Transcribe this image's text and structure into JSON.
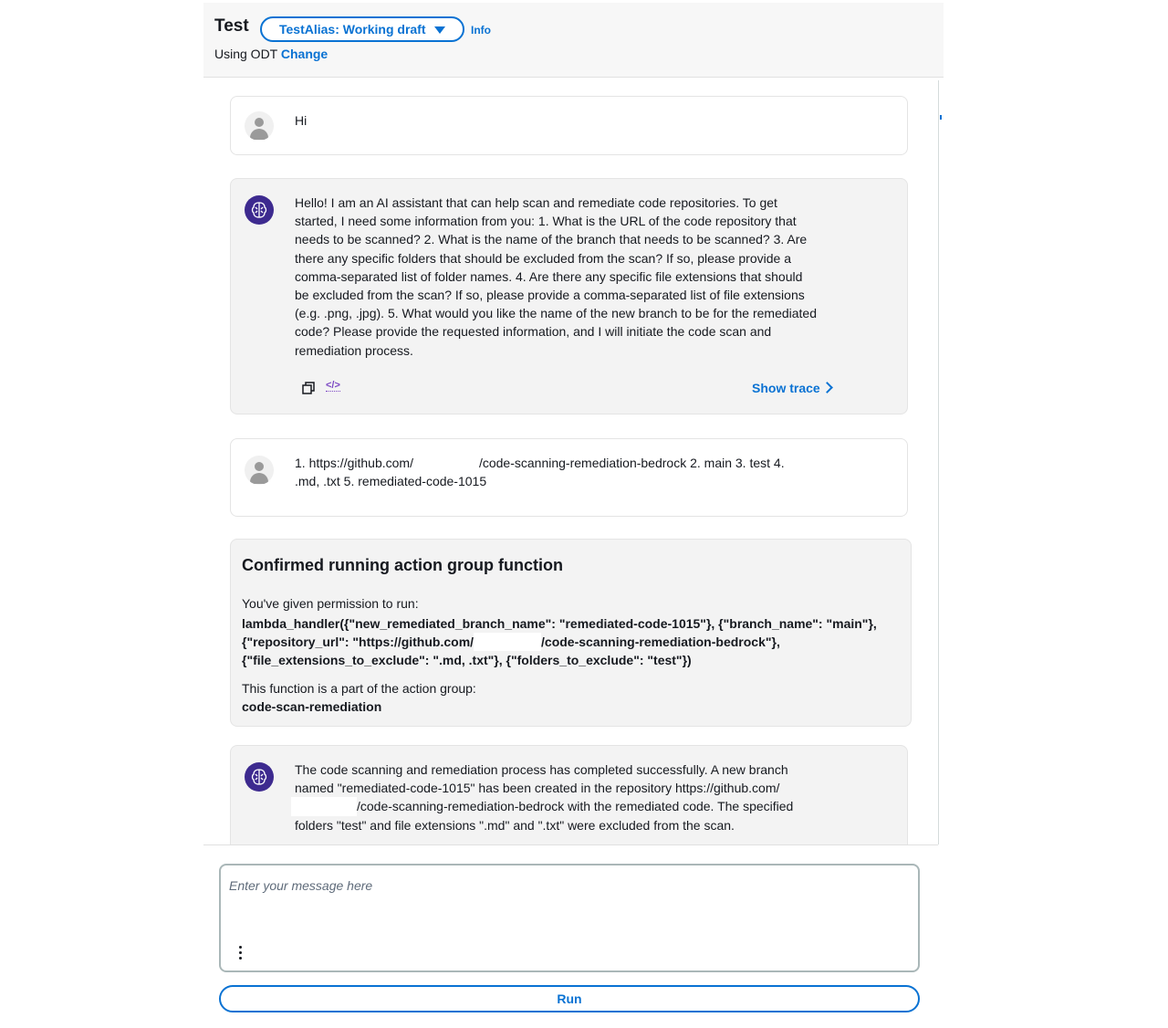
{
  "header": {
    "title": "Test",
    "alias_label": "TestAlias: Working draft",
    "info_label": "Info",
    "using_text": "Using ODT",
    "change_label": "Change"
  },
  "messages": [
    {
      "role": "user",
      "text": "Hi"
    },
    {
      "role": "assistant",
      "lines": [
        "Hello! I am an AI assistant that can help scan and remediate code repositories. To get",
        "started, I need some information from you: 1. What is the URL of the code repository that",
        "needs to be scanned? 2. What is the name of the branch that needs to be scanned? 3. Are",
        "there any specific folders that should be excluded from the scan? If so, please provide a",
        "comma-separated list of folder names. 4. Are there any specific file extensions that should",
        "be excluded from the scan? If so, please provide a comma-separated list of file extensions",
        "(e.g. .png, .jpg). 5. What would you like the name of the new branch to be for the remediated",
        "code? Please provide the requested information, and I will initiate the code scan and",
        "remediation process."
      ],
      "show_trace_label": "Show trace",
      "copy_icon": "copy-icon",
      "code_icon": "code-icon"
    },
    {
      "role": "user",
      "line1_a": "1. https://github.com/",
      "line1_b": "/code-scanning-remediation-bedrock 2. main 3. test 4.",
      "line2": ".md, .txt 5. remediated-code-1015"
    },
    {
      "role": "assistant",
      "line1": "The code scanning and remediation process has completed successfully. A new branch",
      "line2": "named \"remediated-code-1015\" has been created in the repository https://github.com/",
      "line3": "/code-scanning-remediation-bedrock with the remediated code. The specified",
      "line4": "folders \"test\" and file extensions \".md\" and \".txt\" were excluded from the scan."
    }
  ],
  "confirmation": {
    "title": "Confirmed running action group function",
    "permission_text": "You've given permission to run:",
    "code_line1": "lambda_handler({\"new_remediated_branch_name\": \"remediated-code-1015\"}, {\"branch_name\": \"main\"},",
    "code_line2_a": "{\"repository_url\": \"https://github.com/",
    "code_line2_b": "/code-scanning-remediation-bedrock\"},",
    "code_line3": "{\"file_extensions_to_exclude\": \".md, .txt\"}, {\"folders_to_exclude\": \"test\"})",
    "part_text": "This function is a part of the action group:",
    "group_name": "code-scan-remediation"
  },
  "input": {
    "placeholder": "Enter your message here"
  },
  "run_label": "Run",
  "colors": {
    "accent": "#0972d3",
    "bot_avatar": "#3d2a8f",
    "bot_bubble": "#f3f3f3"
  }
}
